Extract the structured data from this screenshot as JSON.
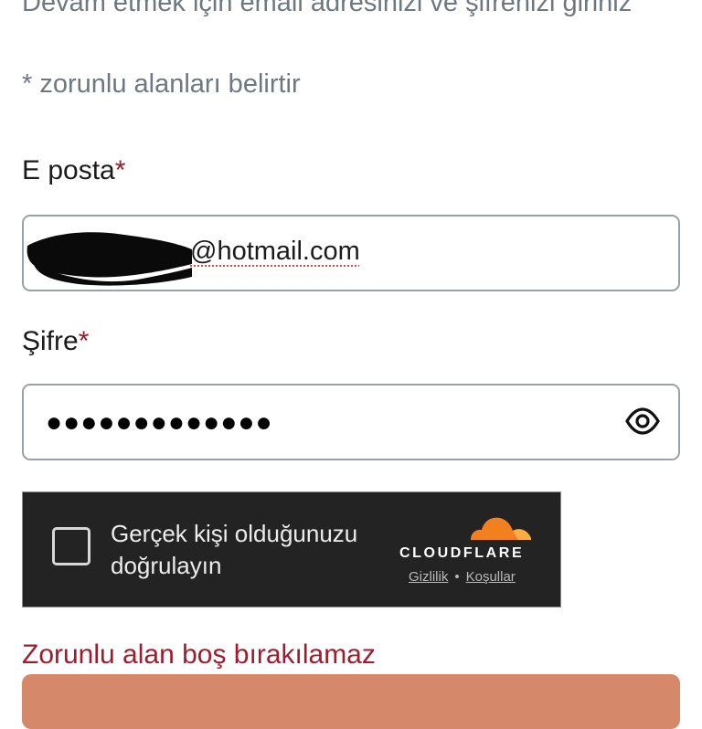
{
  "intro": {
    "text": "Devam etmek için email adresinizi ve şifrenizi giriniz",
    "required_note": "* zorunlu alanları belirtir"
  },
  "email": {
    "label": "E posta",
    "required_mark": "*",
    "value_visible": "@hotmail.com"
  },
  "password": {
    "label": "Şifre",
    "required_mark": "*",
    "masked_value": "●●●●●●●●●●●●●",
    "toggle_icon": "eye-icon"
  },
  "captcha": {
    "text": "Gerçek kişi olduğunuzu doğrulayın",
    "brand": "CLOUDFLARE",
    "privacy_link": "Gizlilik",
    "separator": "•",
    "terms_link": "Koşullar",
    "colors": {
      "background": "#232323",
      "brand_orange": "#f38020"
    }
  },
  "error": {
    "text": "Zorunlu alan boş bırakılamaz",
    "color": "#a01c2c"
  },
  "submit": {
    "color": "#d5896a"
  }
}
